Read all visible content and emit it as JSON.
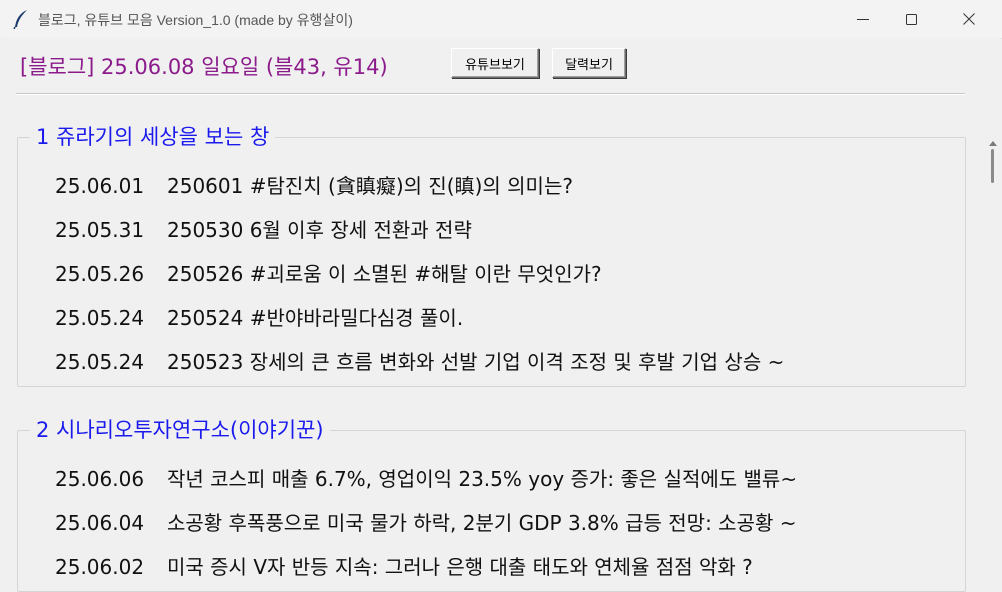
{
  "window": {
    "title": "블로그, 유튜브 모음 Version_1.0 (made by 유행살이)"
  },
  "header": {
    "info": "[블로그] 25.06.08 일요일 (블43, 유14)",
    "youtube_button": "유튜브보기",
    "calendar_button": "달력보기"
  },
  "groups": [
    {
      "title": "1 쥬라기의 세상을 보는 창",
      "items": [
        {
          "date": "25.06.01",
          "text": "250601 #탐진치 (貪瞋癡)의 진(瞋)의 의미는?"
        },
        {
          "date": "25.05.31",
          "text": "250530 6월 이후 장세 전환과 전략"
        },
        {
          "date": "25.05.26",
          "text": "250526  #괴로움 이 소멸된 #해탈 이란 무엇인가?"
        },
        {
          "date": "25.05.24",
          "text": "250524 #반야바라밀다심경 풀이."
        },
        {
          "date": "25.05.24",
          "text": "250523 장세의 큰 흐름 변화와 선발 기업 이격 조정 및 후발 기업 상승 ~"
        }
      ]
    },
    {
      "title": "2 시나리오투자연구소(이야기꾼)",
      "items": [
        {
          "date": "25.06.06",
          "text": "작년 코스피 매출 6.7%, 영업이익 23.5% yoy 증가: 좋은 실적에도 밸류~"
        },
        {
          "date": "25.06.04",
          "text": "소공황 후폭풍으로 미국 물가 하락, 2분기 GDP 3.8% 급등 전망: 소공황 ~"
        },
        {
          "date": "25.06.02",
          "text": "미국 증시 V자 반등 지속: 그러나 은행 대출 태도와 연체율 점점 악화 ?"
        }
      ]
    }
  ],
  "colors": {
    "header_text": "#8b1a8b",
    "group_title": "#1a1aee",
    "row_text": "#111111"
  },
  "icons": {
    "app": "feather-icon",
    "minimize": "minimize-icon",
    "maximize": "maximize-icon",
    "close": "close-icon",
    "scroll_up": "triangle-up-icon"
  }
}
